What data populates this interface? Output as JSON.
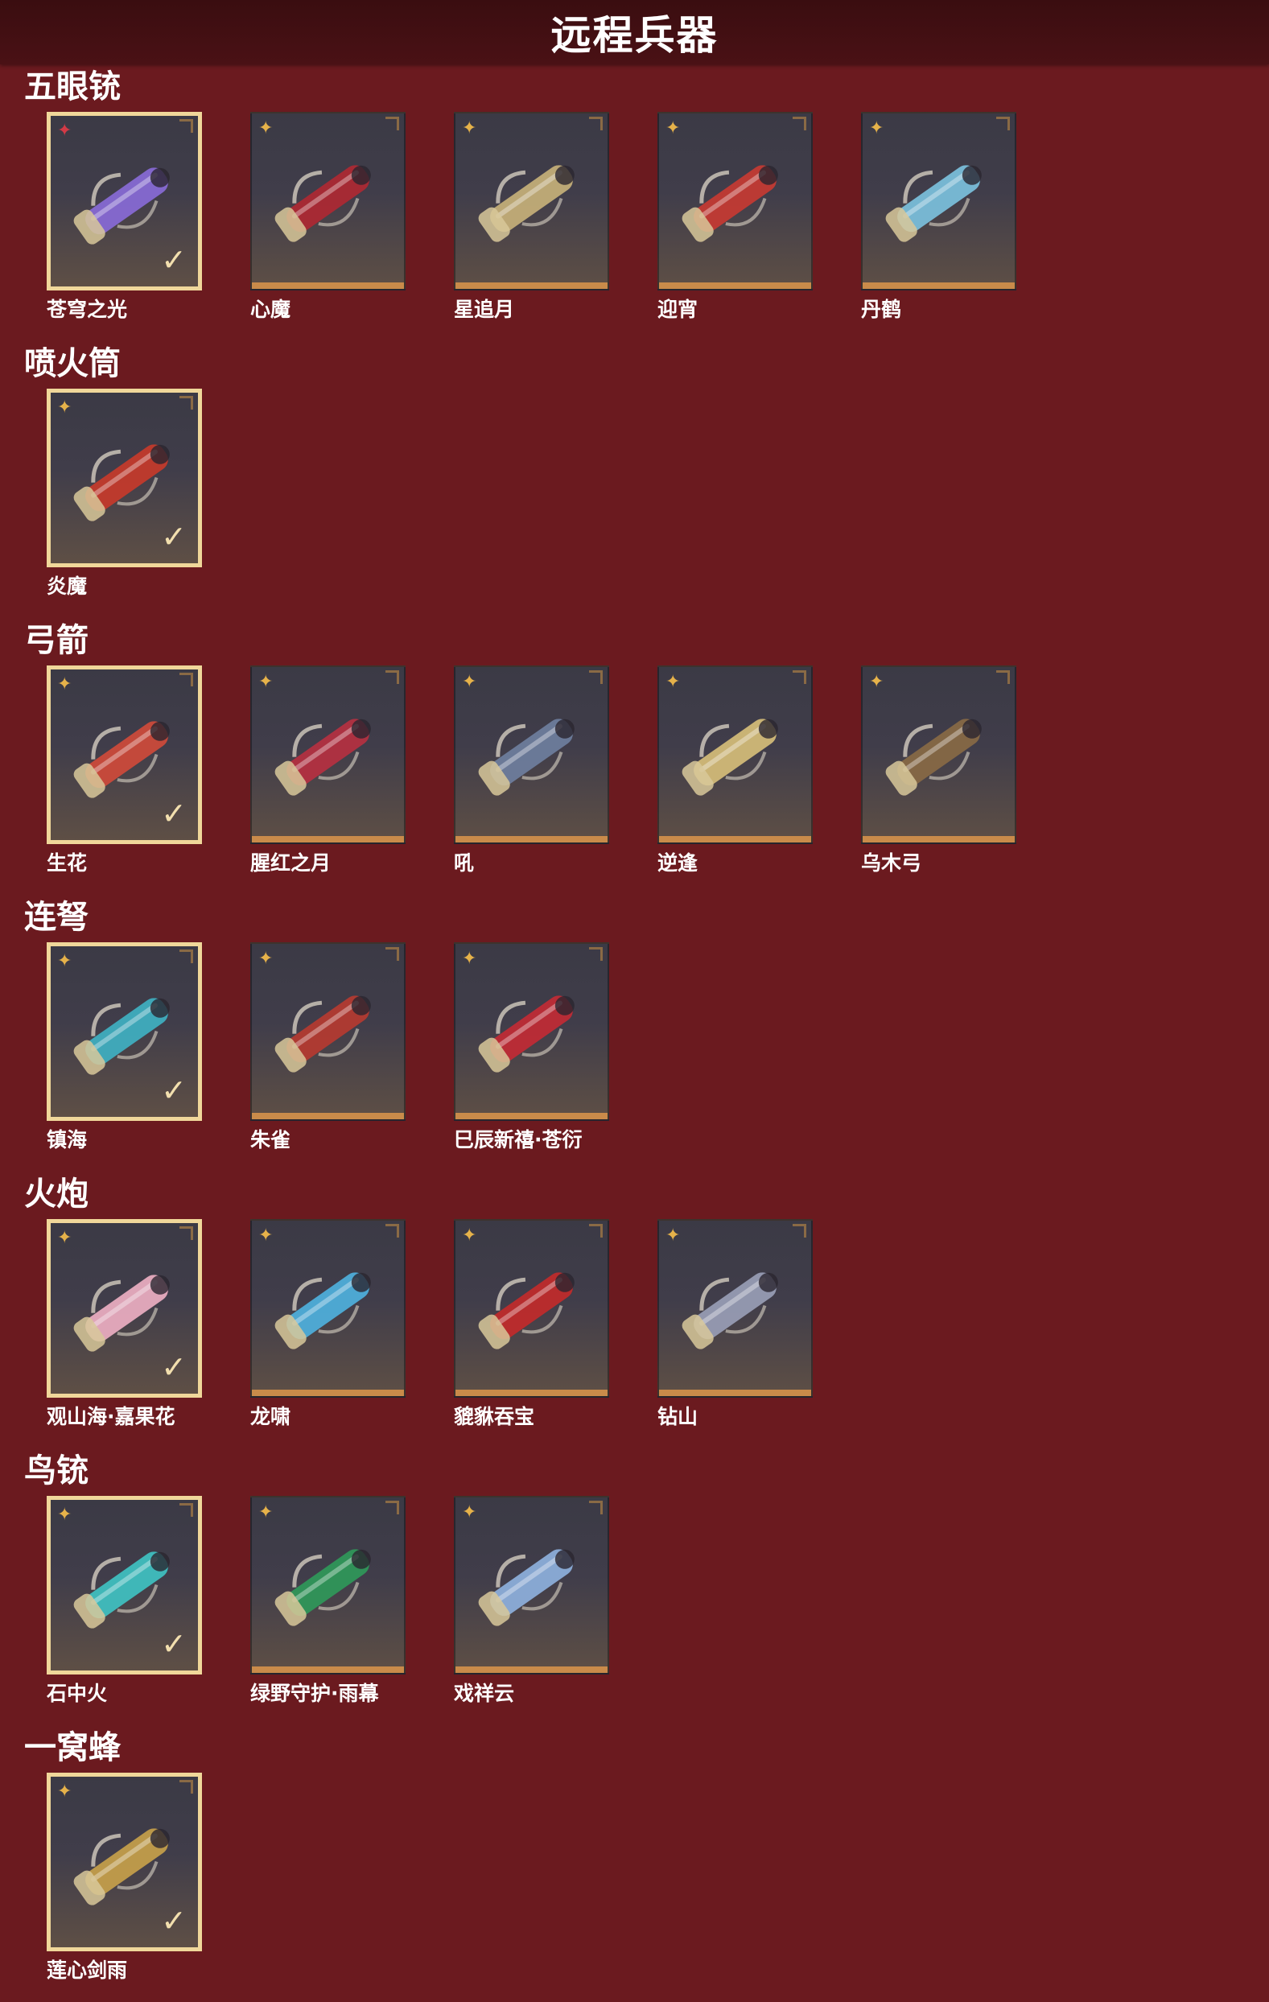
{
  "header": {
    "title": "远程兵器"
  },
  "sections": [
    {
      "title": "五眼铳",
      "items": [
        {
          "label": "苍穹之光",
          "selected": true,
          "badge": "red-star-icon",
          "accent": "#8a6bd9"
        },
        {
          "label": "心魔",
          "selected": false,
          "badge": "gold-star-icon",
          "accent": "#b02832"
        },
        {
          "label": "星追月",
          "selected": false,
          "badge": "gold-star-icon",
          "accent": "#c9b27a"
        },
        {
          "label": "迎宵",
          "selected": false,
          "badge": "gold-star-icon",
          "accent": "#c93a32"
        },
        {
          "label": "丹鹤",
          "selected": false,
          "badge": "gold-star-icon",
          "accent": "#7cc3e0"
        }
      ]
    },
    {
      "title": "喷火筒",
      "items": [
        {
          "label": "炎魔",
          "selected": true,
          "badge": "gold-star-icon",
          "accent": "#c93a2a"
        }
      ]
    },
    {
      "title": "弓箭",
      "items": [
        {
          "label": "生花",
          "selected": true,
          "badge": "gold-star-icon",
          "accent": "#d24a3a"
        },
        {
          "label": "腥红之月",
          "selected": false,
          "badge": "gold-star-icon",
          "accent": "#b83040"
        },
        {
          "label": "吼",
          "selected": false,
          "badge": "gold-star-icon",
          "accent": "#6f7fa0"
        },
        {
          "label": "逆逢",
          "selected": false,
          "badge": "gold-star-icon",
          "accent": "#d8c07a"
        },
        {
          "label": "乌木弓",
          "selected": false,
          "badge": "gold-star-icon",
          "accent": "#8a6a45"
        }
      ]
    },
    {
      "title": "连弩",
      "items": [
        {
          "label": "镇海",
          "selected": true,
          "badge": "gold-star-icon",
          "accent": "#3fb3c4"
        },
        {
          "label": "朱雀",
          "selected": false,
          "badge": "gold-star-icon",
          "accent": "#b83a30"
        },
        {
          "label": "巳辰新禧·苍衍",
          "selected": false,
          "badge": "gold-star-icon",
          "accent": "#c42a34"
        }
      ]
    },
    {
      "title": "火炮",
      "items": [
        {
          "label": "观山海·嘉果花",
          "selected": true,
          "badge": "gold-star-icon",
          "accent": "#f0b0c4"
        },
        {
          "label": "龙啸",
          "selected": false,
          "badge": "gold-star-icon",
          "accent": "#4fb3e0"
        },
        {
          "label": "貔貅吞宝",
          "selected": false,
          "badge": "gold-star-icon",
          "accent": "#c42a2a"
        },
        {
          "label": "钻山",
          "selected": false,
          "badge": "gold-star-icon",
          "accent": "#9aa0b8"
        }
      ]
    },
    {
      "title": "鸟铳",
      "items": [
        {
          "label": "石中火",
          "selected": true,
          "badge": "gold-star-icon",
          "accent": "#3fc4c4"
        },
        {
          "label": "绿野守护·雨幕",
          "selected": false,
          "badge": "gold-star-icon",
          "accent": "#2f9a5a"
        },
        {
          "label": "戏祥云",
          "selected": false,
          "badge": "gold-star-icon",
          "accent": "#8fb3e0"
        }
      ]
    },
    {
      "title": "一窝蜂",
      "items": [
        {
          "label": "莲心剑雨",
          "selected": true,
          "badge": "gold-star-icon",
          "accent": "#c9a24a"
        }
      ]
    }
  ],
  "check_glyph": "✓"
}
